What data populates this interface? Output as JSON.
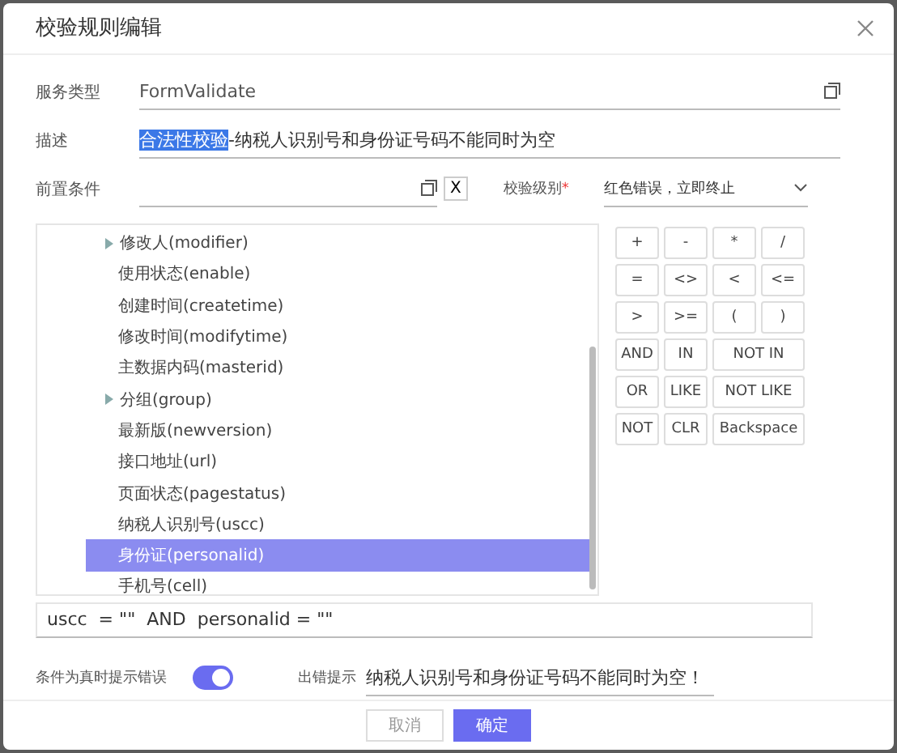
{
  "dialog": {
    "title": "校验规则编辑"
  },
  "service_type": {
    "label": "服务类型",
    "value": "FormValidate"
  },
  "description": {
    "label": "描述",
    "selected_text": "合法性校验",
    "value": "-纳税人识别号和身份证号码不能同时为空"
  },
  "precondition": {
    "label": "前置条件",
    "clear": "X"
  },
  "level": {
    "label": "校验级别",
    "required": "*",
    "value": "红色错误，立即终止"
  },
  "tree": {
    "items": [
      {
        "label": "修改人(modifier)",
        "expandable": true,
        "selected": false
      },
      {
        "label": "使用状态(enable)",
        "expandable": false,
        "selected": false
      },
      {
        "label": "创建时间(createtime)",
        "expandable": false,
        "selected": false
      },
      {
        "label": "修改时间(modifytime)",
        "expandable": false,
        "selected": false
      },
      {
        "label": "主数据内码(masterid)",
        "expandable": false,
        "selected": false
      },
      {
        "label": "分组(group)",
        "expandable": true,
        "selected": false
      },
      {
        "label": "最新版(newversion)",
        "expandable": false,
        "selected": false
      },
      {
        "label": "接口地址(url)",
        "expandable": false,
        "selected": false
      },
      {
        "label": "页面状态(pagestatus)",
        "expandable": false,
        "selected": false
      },
      {
        "label": "纳税人识别号(uscc)",
        "expandable": false,
        "selected": false
      },
      {
        "label": "身份证(personalid)",
        "expandable": false,
        "selected": true
      },
      {
        "label": "手机号(cell)",
        "expandable": false,
        "selected": false
      }
    ]
  },
  "operators": [
    {
      "label": "+",
      "wide": false
    },
    {
      "label": "-",
      "wide": false
    },
    {
      "label": "*",
      "wide": false
    },
    {
      "label": "/",
      "wide": false
    },
    {
      "label": "=",
      "wide": false
    },
    {
      "label": "<>",
      "wide": false
    },
    {
      "label": "<",
      "wide": false
    },
    {
      "label": "<=",
      "wide": false
    },
    {
      "label": ">",
      "wide": false
    },
    {
      "label": ">=",
      "wide": false
    },
    {
      "label": "(",
      "wide": false
    },
    {
      "label": ")",
      "wide": false
    },
    {
      "label": "AND",
      "wide": false
    },
    {
      "label": "IN",
      "wide": false
    },
    {
      "label": "NOT IN",
      "wide": true
    },
    {
      "label": "OR",
      "wide": false
    },
    {
      "label": "LIKE",
      "wide": false
    },
    {
      "label": "NOT LIKE",
      "wide": true
    },
    {
      "label": "NOT",
      "wide": false
    },
    {
      "label": "CLR",
      "wide": false
    },
    {
      "label": "Backspace",
      "wide": true
    }
  ],
  "expression": "uscc  = \"\"  AND  personalid = \"\"",
  "error_prompt": {
    "toggle_label": "条件为真时提示错误",
    "on": true,
    "label": "出错提示",
    "value": "纳税人识别号和身份证号码不能同时为空！"
  },
  "buttons": {
    "cancel": "取消",
    "ok": "确定"
  }
}
